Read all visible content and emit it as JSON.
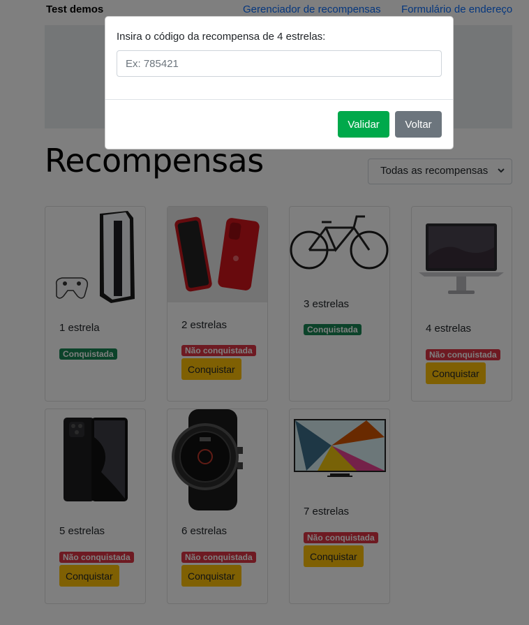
{
  "nav": {
    "brand": "Test demos",
    "links": [
      "Gerenciador de recompensas",
      "Formulário de endereço"
    ]
  },
  "page": {
    "title": "Recompensas",
    "filter": {
      "selected": "Todas as recompensas"
    }
  },
  "cards": [
    {
      "image": "playstation-5",
      "stars": "1 estrela",
      "status": "Conquistada",
      "status_color": "#198754"
    },
    {
      "image": "iphone",
      "stars": "2 estrelas",
      "status": "Não conquistada",
      "status_color": "#dc3545",
      "button": "Conquistar"
    },
    {
      "image": "bicycle",
      "stars": "3 estrelas",
      "status": "Conquistada",
      "status_color": "#198754"
    },
    {
      "image": "macbook",
      "stars": "4 estrelas",
      "status": "Não conquistada",
      "status_color": "#dc3545",
      "button": "Conquistar"
    },
    {
      "image": "xiaomi-phone",
      "stars": "5 estrelas",
      "status": "Não conquistada",
      "status_color": "#dc3545",
      "button": "Conquistar"
    },
    {
      "image": "smartwatch",
      "stars": "6 estrelas",
      "status": "Não conquistada",
      "status_color": "#dc3545",
      "button": "Conquistar"
    },
    {
      "image": "qled-tv",
      "stars": "7 estrelas",
      "status": "Não conquistada",
      "status_color": "#dc3545",
      "button": "Conquistar"
    }
  ],
  "modal": {
    "prompt": "Insira o código da recompensa de 4 estrelas:",
    "input_value": "",
    "input_placeholder": "Ex: 785421",
    "validate_label": "Validar",
    "back_label": "Voltar",
    "validate_color": "#00a94b",
    "back_color": "#6c757d"
  }
}
